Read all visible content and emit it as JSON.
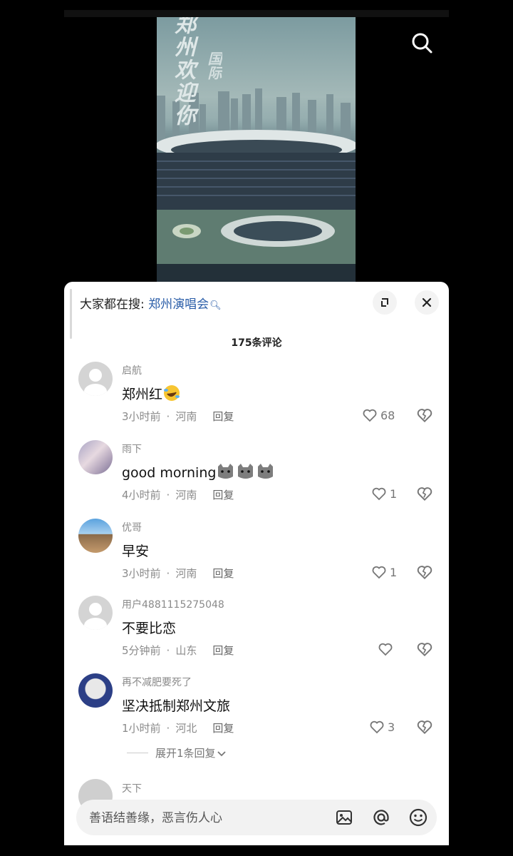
{
  "video": {
    "calligraphy_main": "郑州欢迎你",
    "calligraphy_sub": "国际"
  },
  "header": {
    "search_icon": "search-icon"
  },
  "sheet": {
    "hot_search_prefix": "大家都在搜:",
    "hot_search_keyword": "郑州演唱会",
    "hot_search_icon": "magnifier-small-icon",
    "expand_icon": "expand-icon",
    "close_icon": "close-icon",
    "comment_count": "175条评论"
  },
  "comments": [
    {
      "username": "启航",
      "text": "郑州红",
      "emoji": "rofl-emoji",
      "time": "3小时前",
      "location": "河南",
      "reply": "回复",
      "likes": "68"
    },
    {
      "username": "雨下",
      "text": "good morning",
      "emoji": "cat-emoji x3",
      "time": "4小时前",
      "location": "河南",
      "reply": "回复",
      "likes": "1"
    },
    {
      "username": "优哥",
      "text": "早安",
      "time": "3小时前",
      "location": "河南",
      "reply": "回复",
      "likes": "1"
    },
    {
      "username": "用户4881115275048",
      "text": "不要比恋",
      "time": "5分钟前",
      "location": "山东",
      "reply": "回复",
      "likes": ""
    },
    {
      "username": "再不减肥要死了",
      "text": "坚决抵制郑州文旅",
      "time": "1小时前",
      "location": "河北",
      "reply": "回复",
      "likes": "3"
    }
  ],
  "expand_replies": "展开1条回复",
  "next_comment": {
    "username": "天下"
  },
  "input_bar": {
    "placeholder": "善语结善缘，恶言伤人心",
    "icons": [
      "image-icon",
      "at-icon",
      "emoji-icon"
    ]
  },
  "colors": {
    "accent_link": "#2a5da8",
    "background": "#000000",
    "sheet": "#ffffff"
  }
}
